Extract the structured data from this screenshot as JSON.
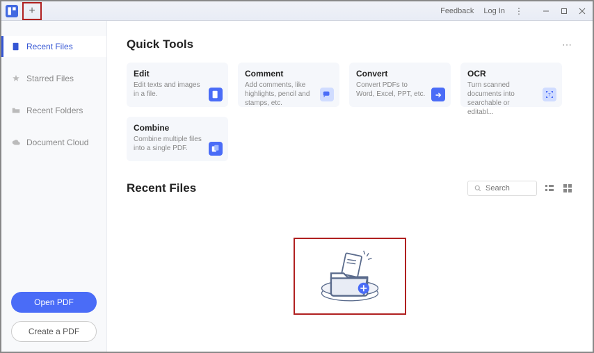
{
  "titlebar": {
    "feedback": "Feedback",
    "login": "Log In"
  },
  "sidebar": {
    "items": [
      {
        "label": "Recent Files"
      },
      {
        "label": "Starred Files"
      },
      {
        "label": "Recent Folders"
      },
      {
        "label": "Document Cloud"
      }
    ],
    "openPdf": "Open PDF",
    "createPdf": "Create a PDF"
  },
  "quickTools": {
    "title": "Quick Tools",
    "tools": [
      {
        "title": "Edit",
        "desc": "Edit texts and images in a file."
      },
      {
        "title": "Comment",
        "desc": "Add comments, like highlights, pencil and stamps, etc."
      },
      {
        "title": "Convert",
        "desc": "Convert PDFs to Word, Excel, PPT, etc."
      },
      {
        "title": "OCR",
        "desc": "Turn scanned documents into searchable or editabl..."
      },
      {
        "title": "Combine",
        "desc": "Combine multiple files into a single PDF."
      }
    ]
  },
  "recent": {
    "title": "Recent Files",
    "searchPlaceholder": "Search"
  }
}
